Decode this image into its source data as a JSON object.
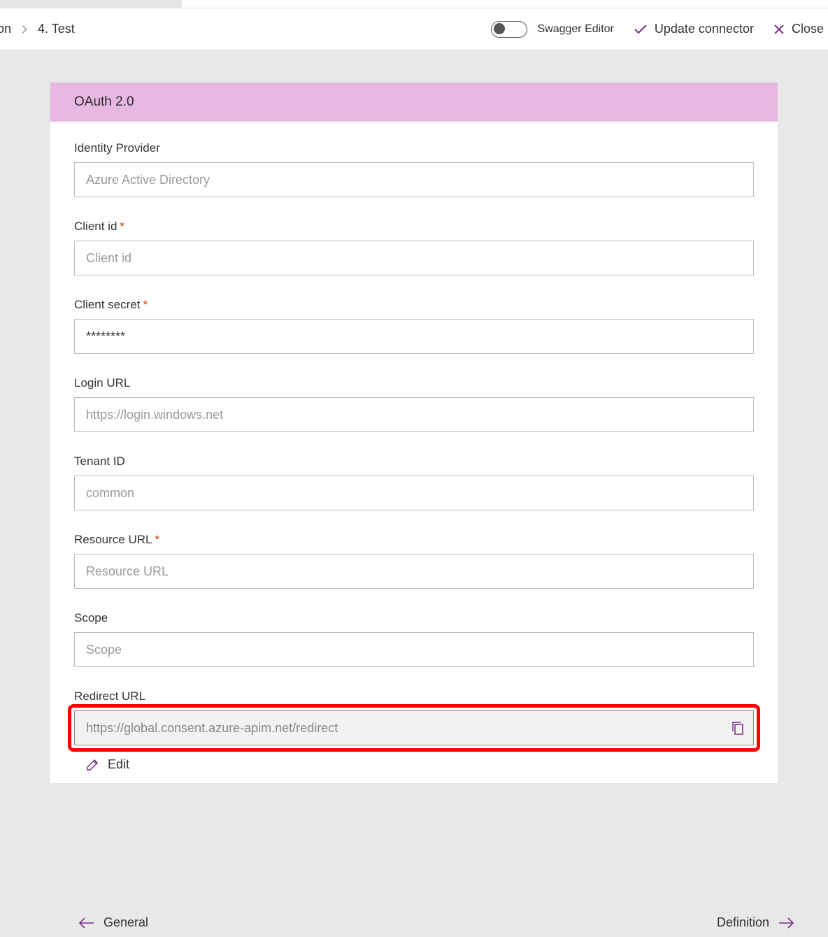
{
  "breadcrumb": {
    "prev_fragment": "on",
    "current": "4. Test"
  },
  "toolbar": {
    "swagger_label": "Swagger Editor",
    "update_label": "Update connector",
    "close_label": "Close"
  },
  "card": {
    "header": "OAuth 2.0"
  },
  "form": {
    "identity_provider": {
      "label": "Identity Provider",
      "value": "Azure Active Directory"
    },
    "client_id": {
      "label": "Client id",
      "placeholder": "Client id",
      "value": ""
    },
    "client_secret": {
      "label": "Client secret",
      "value": "********"
    },
    "login_url": {
      "label": "Login URL",
      "value": "https://login.windows.net"
    },
    "tenant_id": {
      "label": "Tenant ID",
      "value": "common"
    },
    "resource_url": {
      "label": "Resource URL",
      "placeholder": "Resource URL",
      "value": ""
    },
    "scope": {
      "label": "Scope",
      "placeholder": "Scope",
      "value": ""
    },
    "redirect_url": {
      "label": "Redirect URL",
      "value": "https://global.consent.azure-apim.net/redirect"
    },
    "edit_label": "Edit"
  },
  "footer": {
    "prev": "General",
    "next": "Definition"
  }
}
